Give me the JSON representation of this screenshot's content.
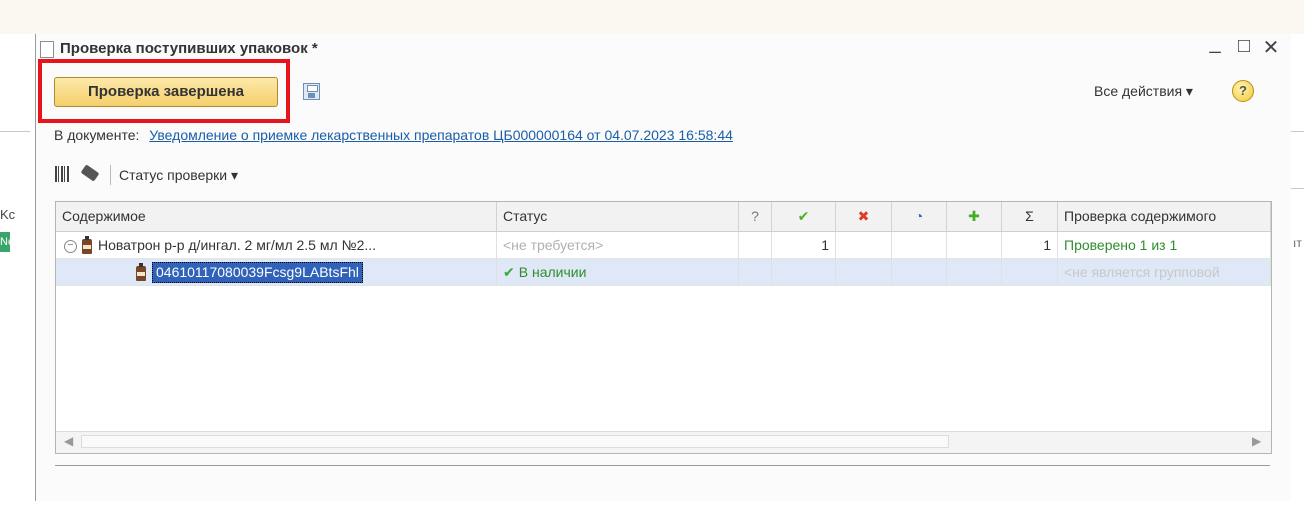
{
  "background": {
    "left_fragment_1": "Kc",
    "left_fragment_2": "Nє",
    "right_fragment": "ıт"
  },
  "window": {
    "title": "Проверка поступивших упаковок *",
    "controls": {
      "minimize": "_",
      "maximize": "□",
      "close": "✕"
    }
  },
  "toolbar": {
    "main_button_label": "Проверка завершена",
    "all_actions_label": "Все действия ▾",
    "help_label": "?"
  },
  "document": {
    "label": "В документе:",
    "link_text": "Уведомление о приемке лекарственных препаратов ЦБ000000164 от 04.07.2023 16:58:44"
  },
  "subtoolbar": {
    "status_check_label": "Статус проверки ▾"
  },
  "table": {
    "columns": {
      "content": "Содержимое",
      "status": "Статус",
      "unknown": "?",
      "checked": "✔",
      "rejected": "✖",
      "pending": "◔",
      "added": "✚",
      "total": "Σ",
      "content_check": "Проверка содержимого"
    },
    "rows": [
      {
        "content": "Новатрон р-р д/ингал. 2 мг/мл 2.5 мл №2...",
        "status": "<не требуется>",
        "unknown": "",
        "checked": "1",
        "rejected": "",
        "pending": "",
        "added": "",
        "total": "1",
        "content_check": "Проверено 1 из 1"
      },
      {
        "content": "04610117080039Fcsg9LABtsFhl",
        "status": "В наличии",
        "unknown": "",
        "checked": "",
        "rejected": "",
        "pending": "",
        "added": "",
        "total": "",
        "content_check": "<не является групповой"
      }
    ]
  },
  "colors": {
    "highlight_outline": "#e8141c",
    "main_button": "#f4cf6c",
    "link": "#1a5ea8",
    "selection": "#2f62b8",
    "green_text": "#2f8d2f",
    "scrollbar_highlight": "#23e81f"
  },
  "icons": {
    "title": "document-icon",
    "save": "save-icon",
    "help": "help-icon",
    "barcode": "barcode-icon",
    "eraser": "eraser-icon",
    "collapse": "collapse-icon",
    "bottle": "medicine-bottle-icon"
  }
}
